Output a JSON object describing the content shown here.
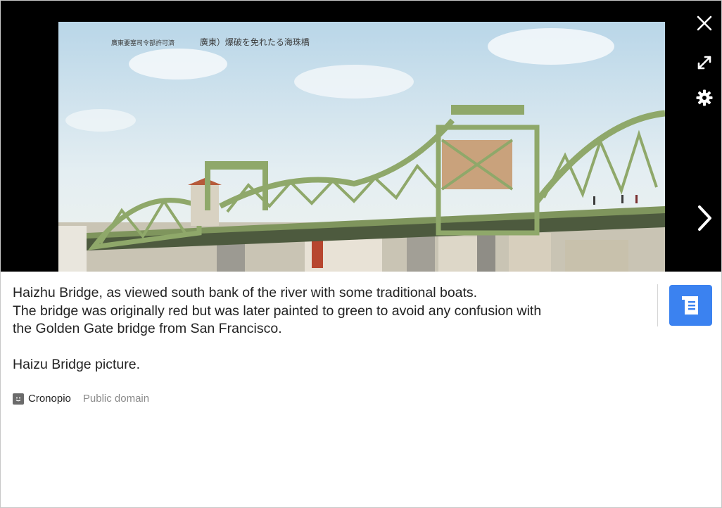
{
  "image": {
    "alt": "Haizhu Bridge",
    "caption_printed": {
      "right": "廣東）爆破を免れたる海珠橋",
      "left": "廣東要塞司令部許可濟"
    }
  },
  "controls": {
    "close_icon": "close-icon",
    "expand_icon": "expand-icon",
    "settings_icon": "gear-icon",
    "next_icon": "chevron-right-icon"
  },
  "description": {
    "line1": "Haizhu Bridge, as viewed south bank of the river with some traditional boats.",
    "line2": "The bridge was originally red but was later painted to green to avoid any confusion with",
    "line3": "the Golden Gate bridge from San Francisco.",
    "line4": "Haizu Bridge picture."
  },
  "attribution": {
    "author": "Cronopio",
    "license": "Public domain"
  },
  "colors": {
    "stage_bg": "#000000",
    "accent": "#3b82f0",
    "bridge_green": "#8fa86a"
  }
}
